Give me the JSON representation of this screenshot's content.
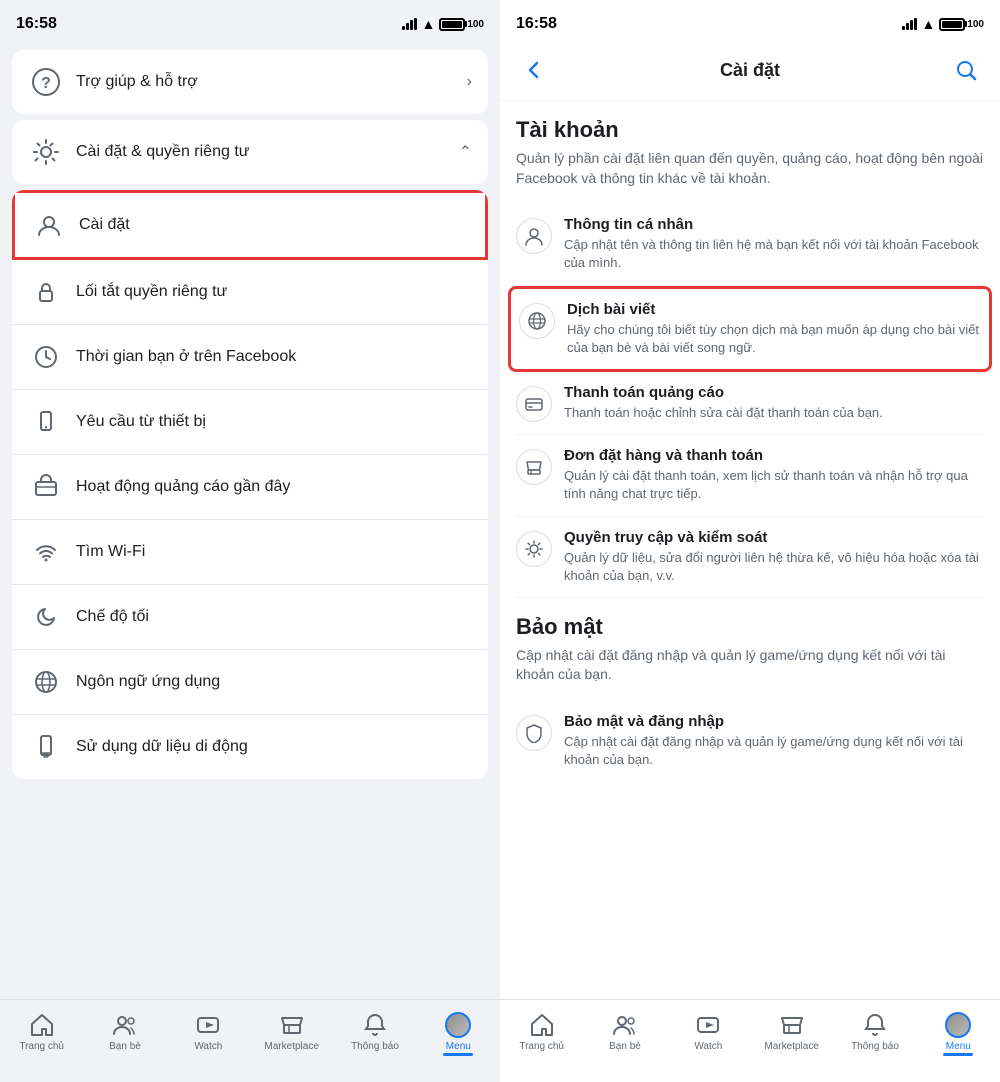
{
  "left": {
    "status": {
      "time": "16:58",
      "battery": "100"
    },
    "help_section": {
      "label": "Trợ giúp & hỗ trợ",
      "icon": "❓"
    },
    "settings_section": {
      "label": "Cài đặt & quyền riêng tư",
      "icon": "⚙️"
    },
    "sub_items": [
      {
        "label": "Cài đặt",
        "icon": "person"
      },
      {
        "label": "Lối tắt quyền riêng tư",
        "icon": "lock"
      },
      {
        "label": "Thời gian bạn ở trên Facebook",
        "icon": "clock"
      },
      {
        "label": "Yêu cầu từ thiết bị",
        "icon": "phone"
      },
      {
        "label": "Hoạt động quảng cáo gần đây",
        "icon": "ad"
      },
      {
        "label": "Tìm Wi-Fi",
        "icon": "wifi"
      },
      {
        "label": "Chế độ tối",
        "icon": "moon"
      },
      {
        "label": "Ngôn ngữ ứng dụng",
        "icon": "globe"
      },
      {
        "label": "Sử dụng dữ liệu di động",
        "icon": "phone2"
      }
    ],
    "tabs": [
      {
        "label": "Trang chủ",
        "icon": "home",
        "active": false
      },
      {
        "label": "Bạn bè",
        "icon": "friends",
        "active": false
      },
      {
        "label": "Watch",
        "icon": "watch",
        "active": false
      },
      {
        "label": "Marketplace",
        "icon": "marketplace",
        "active": false
      },
      {
        "label": "Thông báo",
        "icon": "bell",
        "active": false
      },
      {
        "label": "Menu",
        "icon": "menu",
        "active": true
      }
    ]
  },
  "right": {
    "status": {
      "time": "16:58",
      "battery": "100"
    },
    "header": {
      "title": "Cài đặt",
      "back_label": "‹",
      "search_label": "🔍"
    },
    "tai_khoan": {
      "title": "Tài khoản",
      "desc": "Quản lý phần cài đặt liên quan đến quyền, quảng cáo, hoạt động bên ngoài Facebook và thông tin khác về tài khoản.",
      "items": [
        {
          "title": "Thông tin cá nhân",
          "desc": "Cập nhật tên và thông tin liên hệ mà bạn kết nối với tài khoản Facebook của mình.",
          "icon": "person"
        },
        {
          "title": "Dịch bài viết",
          "desc": "Hãy cho chúng tôi biết tùy chọn dịch mà bạn muốn áp dụng cho bài viết của bạn bè và bài viết song ngữ.",
          "icon": "globe",
          "highlighted": true
        },
        {
          "title": "Thanh toán quảng cáo",
          "desc": "Thanh toán hoặc chỉnh sửa cài đặt thanh toán của bạn.",
          "icon": "card"
        },
        {
          "title": "Đơn đặt hàng và thanh toán",
          "desc": "Quản lý cài đặt thanh toán, xem lịch sử thanh toán và nhận hỗ trợ qua tính năng chat trực tiếp.",
          "icon": "box"
        },
        {
          "title": "Quyền truy cập và kiểm soát",
          "desc": "Quản lý dữ liệu, sửa đổi người liên hệ thừa kế, vô hiệu hóa hoặc xóa tài khoản của bạn, v.v.",
          "icon": "gear2"
        }
      ]
    },
    "bao_mat": {
      "title": "Bảo mật",
      "desc": "Cập nhật cài đặt đăng nhập và quản lý game/ứng dụng kết nối với tài khoản của bạn.",
      "items": [
        {
          "title": "Bảo mật và đăng nhập",
          "desc": "Cập nhật cài đặt đăng nhập và quản lý game/ứng dụng kết nối với tài khoản của bạn.",
          "icon": "shield"
        }
      ]
    },
    "tabs": [
      {
        "label": "Trang chủ",
        "icon": "home",
        "active": false
      },
      {
        "label": "Bạn bè",
        "icon": "friends",
        "active": false
      },
      {
        "label": "Watch",
        "icon": "watch",
        "active": false
      },
      {
        "label": "Marketplace",
        "icon": "marketplace",
        "active": false
      },
      {
        "label": "Thông báo",
        "icon": "bell",
        "active": false
      },
      {
        "label": "Menu",
        "icon": "menu",
        "active": true
      }
    ]
  }
}
